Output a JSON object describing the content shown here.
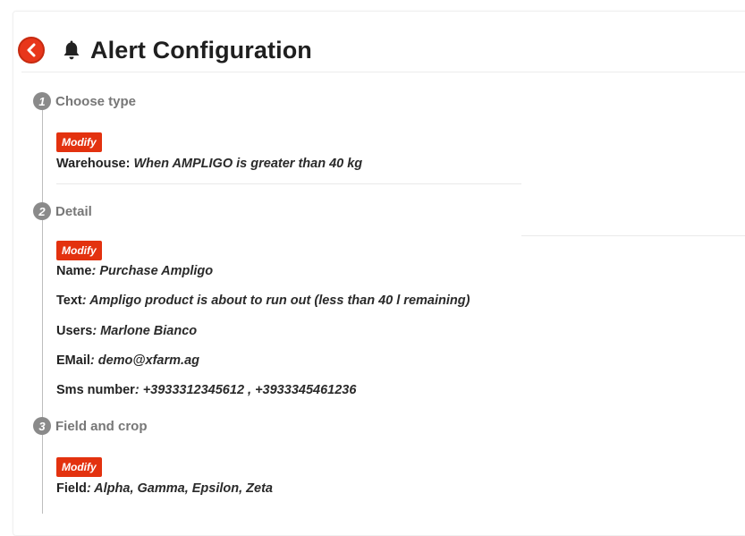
{
  "header": {
    "title": "Alert Configuration",
    "back_icon": "chevron-left-icon",
    "title_icon": "bell-icon"
  },
  "colors": {
    "accent": "#e3320f",
    "step_badge": "#8a8a8a"
  },
  "steps": [
    {
      "number": "1",
      "title": "Choose type",
      "modify_label": "Modify",
      "lines": [
        {
          "label": "Warehouse:",
          "value": "When AMPLIGO is greater than 40 kg"
        }
      ]
    },
    {
      "number": "2",
      "title": "Detail",
      "modify_label": "Modify",
      "lines": [
        {
          "label": "Name",
          "value": ": Purchase Ampligo"
        },
        {
          "label": "Text",
          "value": ": Ampligo product is about to run out (less than 40 l remaining)"
        },
        {
          "label": "Users",
          "value": ": Marlone Bianco"
        },
        {
          "label": "EMail",
          "value": ": demo@xfarm.ag"
        },
        {
          "label": "Sms number",
          "value": ": +3933312345612 , +3933345461236"
        }
      ]
    },
    {
      "number": "3",
      "title": "Field and crop",
      "modify_label": "Modify",
      "lines": [
        {
          "label": "Field",
          "value": ": Alpha, Gamma, Epsilon, Zeta"
        }
      ]
    }
  ]
}
